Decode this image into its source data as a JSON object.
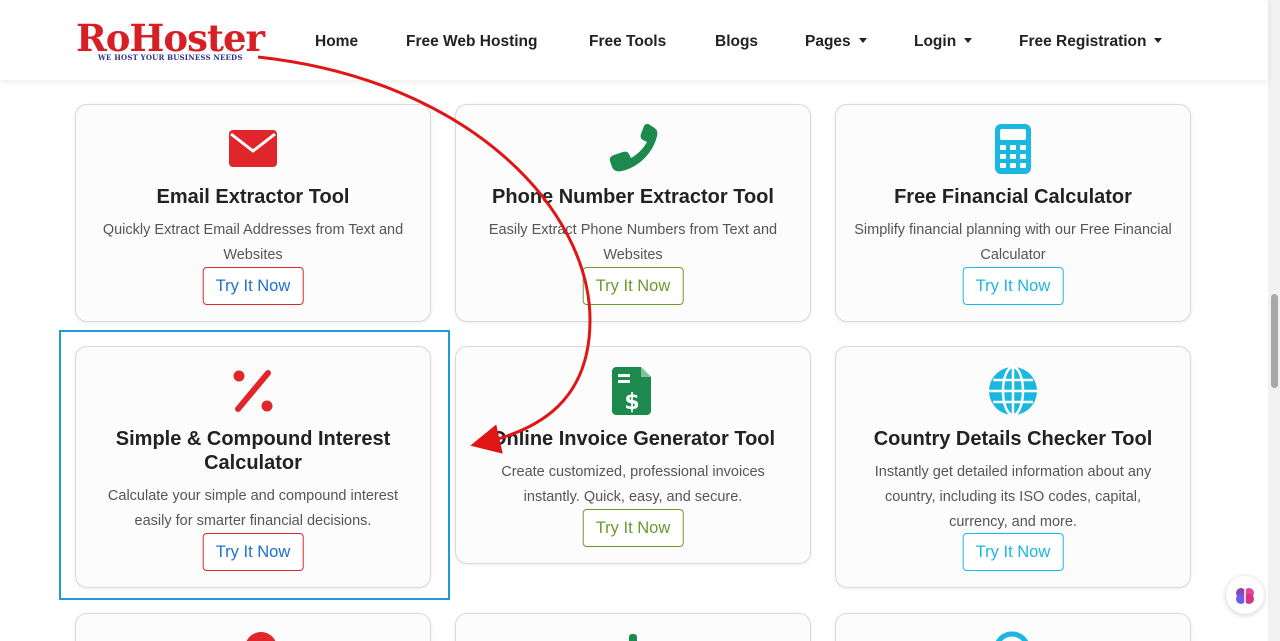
{
  "logo": {
    "brand": "RoHoster",
    "tagline": "WE HOST YOUR BUSINESS NEEDS"
  },
  "nav": {
    "home": "Home",
    "hosting": "Free Web Hosting",
    "tools": "Free Tools",
    "blogs": "Blogs",
    "pages": "Pages",
    "login": "Login",
    "registration": "Free Registration"
  },
  "cards": [
    {
      "title": "Email Extractor Tool",
      "desc": "Quickly Extract Email Addresses from Text and Websites",
      "button": "Try It Now",
      "icon": "envelope-icon",
      "color": "#e0262a"
    },
    {
      "title": "Phone Number Extractor Tool",
      "desc": "Easily Extract Phone Numbers from Text and Websites",
      "button": "Try It Now",
      "icon": "phone-icon",
      "color": "#1b8a4c"
    },
    {
      "title": "Free Financial Calculator",
      "desc": "Simplify financial planning with our Free Financial Calculator",
      "button": "Try It Now",
      "icon": "calculator-icon",
      "color": "#1ab7e0"
    },
    {
      "title": "Simple & Compound Interest Calculator",
      "desc": "Calculate your simple and compound interest easily for smarter financial decisions.",
      "button": "Try It Now",
      "icon": "percent-icon",
      "color": "#e0262a"
    },
    {
      "title": "Online Invoice Generator Tool",
      "desc": "Create customized, professional invoices instantly. Quick, easy, and secure.",
      "button": "Try It Now",
      "icon": "invoice-icon",
      "color": "#1b8a4c"
    },
    {
      "title": "Country Details Checker Tool",
      "desc": "Instantly get detailed information about any country, including its ISO codes, capital, currency, and more.",
      "button": "Try It Now",
      "icon": "globe-icon",
      "color": "#1ab7e0"
    }
  ],
  "colors": {
    "red": "#e0262a",
    "green": "#1b8a4c",
    "cyan": "#1ab7e0",
    "arrow": "#e01515",
    "highlight": "#1e9ad6",
    "button_text_blue": "#1e6fd0",
    "button_text_green": "#6a9a2e"
  }
}
